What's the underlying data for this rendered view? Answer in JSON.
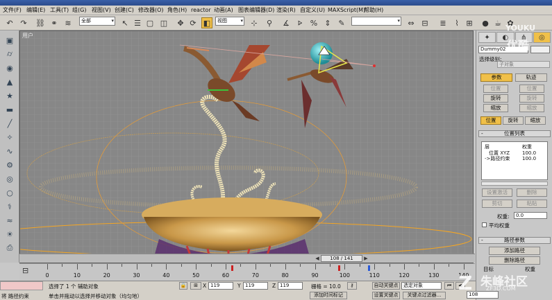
{
  "app": {
    "title": ""
  },
  "menu": [
    "文件(F)",
    "编辑(E)",
    "工具(T)",
    "组(G)",
    "视图(V)",
    "创建(C)",
    "修改器(O)",
    "角色(H)",
    "reactor",
    "动画(A)",
    "图表编辑器(D)",
    "渲染(R)",
    "自定义(U)",
    "MAXScript(M)",
    "帮助(H)"
  ],
  "toolbar": {
    "selection_filter": "全部",
    "reference_coord": "视图"
  },
  "viewport": {
    "label": "用户"
  },
  "command_panel": {
    "object_name": "Dummy02",
    "select_track_label": "选择级别:",
    "subobject_dropdown": "子对象",
    "tab_params": "参数",
    "tab_tracks": "轨迹",
    "btn_position": "位置",
    "btn_position2": "位置",
    "btn_rotate": "旋转",
    "btn_rotate2": "旋转",
    "btn_scale": "缩放",
    "btn_scale2": "缩放",
    "sub_position": "位置",
    "sub_rotate": "旋转",
    "sub_scale": "缩放",
    "rollout_position_list": "位置列表",
    "list_header_layer": "层",
    "list_header_weight": "权重",
    "list_row_1_name": "位置 XYZ",
    "list_row_1_weight": "100.0",
    "list_row_2_name": "->路径约束",
    "list_row_2_weight": "100.0",
    "btn_set_active": "设置激活",
    "btn_delete": "删除",
    "btn_cut": "剪切",
    "btn_paste": "粘贴",
    "weight_label": "权重:",
    "weight_value": "0.0",
    "average_weights": "平均权重",
    "rollout_path_params": "路径参数",
    "btn_add_path": "添加路径",
    "btn_delete_path": "删除路径",
    "target_label": "目标",
    "target_weight_label": "权重"
  },
  "timeline": {
    "current": "108 / 141",
    "ticks": [
      0,
      10,
      20,
      30,
      40,
      50,
      60,
      70,
      80,
      90,
      100,
      110,
      120,
      130,
      140
    ],
    "range": [
      0,
      141
    ],
    "keys": [
      62,
      98,
      108
    ]
  },
  "status": {
    "selected": "选择了 1 个 辅助对象",
    "prompt": "单击并拖动以选择并移动对象（均匀地）",
    "left_label": "将 路径约束",
    "x_label": "X",
    "x_value": "119",
    "y_label": "Y",
    "y_value": "119",
    "z_label": "Z",
    "z_value": "119",
    "grid_label": "栅格 = 10.0",
    "auto_key": "自动关键点",
    "set_key": "设置关键点",
    "selected_object": "选定对象",
    "key_filters": "关键点过滤器...",
    "add_time_tag": "添加时间标记",
    "frame": "108"
  },
  "watermarks": {
    "youku_top": "YOUKU",
    "youku_bottom": "优酷",
    "site_cn": "朱峰社区",
    "site_url": "ZF3D.COM"
  },
  "colors": {
    "accent": "#f0c049",
    "viewport_bg": "#878787",
    "active_key": "#cc2222"
  }
}
